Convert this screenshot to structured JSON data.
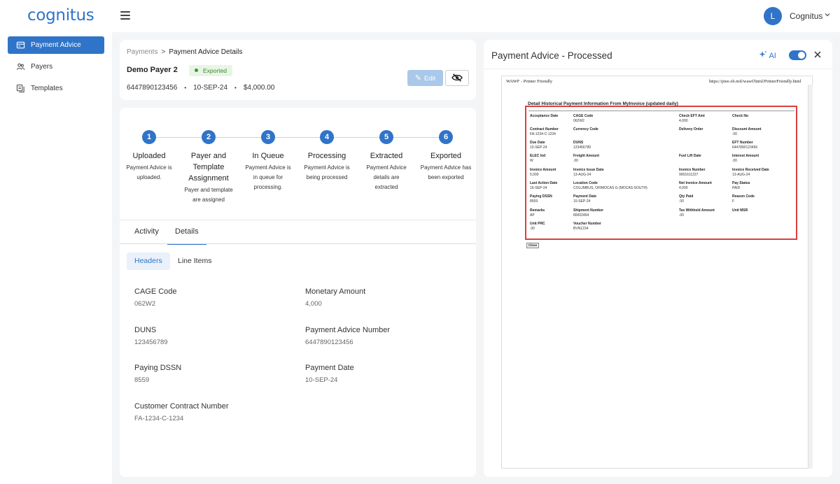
{
  "app": {
    "logo": "cognitus",
    "user_initial": "L",
    "user_name": "Cognitus"
  },
  "sidebar": {
    "items": [
      {
        "label": "Payment Advice",
        "active": true
      },
      {
        "label": "Payers",
        "active": false
      },
      {
        "label": "Templates",
        "active": false
      }
    ]
  },
  "header": {
    "breadcrumb": {
      "parent": "Payments",
      "separator": ">",
      "current": "Payment Advice Details"
    },
    "payer_name": "Demo Payer 2",
    "status_badge": "Exported",
    "advice_number": "6447890123456",
    "date": "10-SEP-24",
    "amount": "$4,000.00",
    "edit_label": "Edit"
  },
  "steps": [
    {
      "num": "1",
      "title": "Uploaded",
      "desc": "Payment Advice is uploaded."
    },
    {
      "num": "2",
      "title": "Payer and Template Assignment",
      "desc": "Payer and template are assigned"
    },
    {
      "num": "3",
      "title": "In Queue",
      "desc": "Payment Advice is in queue for processing."
    },
    {
      "num": "4",
      "title": "Processing",
      "desc": "Payment Advice is being processed"
    },
    {
      "num": "5",
      "title": "Extracted",
      "desc": "Payment Advice details are extracted"
    },
    {
      "num": "6",
      "title": "Exported",
      "desc": "Payment Advice has been exported"
    }
  ],
  "tabs": {
    "activity": "Activity",
    "details": "Details"
  },
  "subtabs": {
    "headers": "Headers",
    "line_items": "Line Items"
  },
  "fields": {
    "cage_code": {
      "label": "CAGE Code",
      "value": "062W2"
    },
    "monetary_amount": {
      "label": "Monetary Amount",
      "value": "4,000"
    },
    "duns": {
      "label": "DUNS",
      "value": "123456789"
    },
    "payment_advice_number": {
      "label": "Payment Advice Number",
      "value": "6447890123456"
    },
    "paying_dssn": {
      "label": "Paying DSSN",
      "value": "8559"
    },
    "payment_date": {
      "label": "Payment Date",
      "value": "10-SEP-24"
    },
    "customer_contract_number": {
      "label": "Customer Contract Number",
      "value": "FA-1234-C-1234"
    }
  },
  "right_panel": {
    "title": "Payment Advice - Processed",
    "ai_label": "AI",
    "doc": {
      "header_left": "WAWF - Printer Friendly",
      "header_right": "https://piee.eb.mil/wawf/html/PrinterFriendly.html",
      "heading": "Detail Historical Payment Information From MyInvoice (updated daily)",
      "close": "Close",
      "cells": {
        "acceptance_date": {
          "k": "Acceptance Date",
          "v": ""
        },
        "cage_code": {
          "k": "CAGE Code",
          "v": "062W2"
        },
        "check_eft_amt": {
          "k": "Check EFT Amt",
          "v": "4,000"
        },
        "check_no": {
          "k": "Check No",
          "v": ""
        },
        "contract_number": {
          "k": "Contract Number",
          "v": "FA-1234-C-1234"
        },
        "currency_code": {
          "k": "Currency Code",
          "v": ""
        },
        "delivery_order": {
          "k": "Delivery Order",
          "v": ""
        },
        "discount_amount": {
          "k": "Discount Amount",
          "v": ".00"
        },
        "due_date": {
          "k": "Due Date",
          "v": "10-SEP-24"
        },
        "duns": {
          "k": "DUNS",
          "v": "123456789"
        },
        "eft_number": {
          "k": "EFT Number",
          "v": "6447890123456"
        },
        "elec_ind": {
          "k": "ELEC Ind",
          "v": "W"
        },
        "freight_amount": {
          "k": "Freight Amount",
          "v": ".00"
        },
        "fuel_lift_date": {
          "k": "Fuel Lift Date",
          "v": ""
        },
        "interest_amount": {
          "k": "Interest Amount",
          "v": ".00"
        },
        "invoice_amount": {
          "k": "Invoice Amount",
          "v": "5,000"
        },
        "invoice_issue_date": {
          "k": "Invoice Issue Date",
          "v": "13-AUG-24"
        },
        "invoice_number": {
          "k": "Invoice Number",
          "v": "9001611227"
        },
        "invoice_received_date": {
          "k": "Invoice Received Date",
          "v": "13-AUG-24"
        },
        "last_action_date": {
          "k": "Last Action Date",
          "v": "16-SEP-24"
        },
        "location_code": {
          "k": "Location Code",
          "v": "COLUMBUS, OH/MOCAS G (MOCAS-SOUTH)"
        },
        "net_invoice_amount": {
          "k": "Net Invoice Amount",
          "v": "4,000"
        },
        "pay_status": {
          "k": "Pay Status",
          "v": "PAID"
        },
        "paying_dssn": {
          "k": "Paying DSSN",
          "v": "8559"
        },
        "payment_date": {
          "k": "Payment Date",
          "v": "10-SEP-24"
        },
        "qty_paid": {
          "k": "Qty Paid",
          "v": ".00"
        },
        "reason_code": {
          "k": "Reason Code",
          "v": "F"
        },
        "remarks": {
          "k": "Remarks",
          "v": "AP"
        },
        "shipment_number": {
          "k": "Shipment Number",
          "v": "80002494"
        },
        "tax_withheld_amount": {
          "k": "Tax Withheld Amount",
          "v": ".00"
        },
        "unit_msr": {
          "k": "Unit MSR",
          "v": ""
        },
        "unit_prc": {
          "k": "Unit PRC",
          "v": ".00"
        },
        "voucher_number": {
          "k": "Voucher Number",
          "v": "BVN1234"
        }
      }
    }
  },
  "colors": {
    "accent": "#2f74c8",
    "success": "#3a8a2a",
    "highlight_border": "#d94040"
  }
}
